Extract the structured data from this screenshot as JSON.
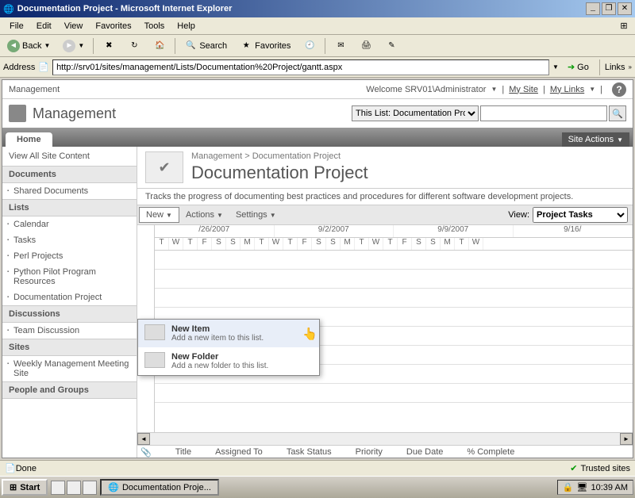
{
  "window": {
    "title": "Documentation Project - Microsoft Internet Explorer"
  },
  "menu": {
    "items": [
      "File",
      "Edit",
      "View",
      "Favorites",
      "Tools",
      "Help"
    ]
  },
  "toolbar": {
    "back": "Back",
    "search": "Search",
    "favorites": "Favorites"
  },
  "address": {
    "label": "Address",
    "url": "http://srv01/sites/management/Lists/Documentation%20Project/gantt.aspx",
    "go": "Go",
    "links": "Links"
  },
  "sp": {
    "topsite": "Management",
    "welcome": "Welcome SRV01\\Administrator",
    "mysite": "My Site",
    "mylinks": "My Links",
    "title": "Management",
    "scope": "This List: Documentation Project",
    "hometab": "Home",
    "siteactions": "Site Actions"
  },
  "sidebar": {
    "viewall": "View All Site Content",
    "sections": {
      "documents": {
        "title": "Documents",
        "items": [
          "Shared Documents"
        ]
      },
      "lists": {
        "title": "Lists",
        "items": [
          "Calendar",
          "Tasks",
          "Perl Projects",
          "Python Pilot Program Resources",
          "Documentation Project"
        ]
      },
      "discussions": {
        "title": "Discussions",
        "items": [
          "Team Discussion"
        ]
      },
      "sites": {
        "title": "Sites",
        "items": [
          "Weekly Management Meeting Site"
        ]
      },
      "people": {
        "title": "People and Groups"
      }
    }
  },
  "page": {
    "breadcrumb": "Management > Documentation Project",
    "title": "Documentation Project",
    "description": "Tracks the progress of documenting best practices and procedures for different software development projects."
  },
  "listbar": {
    "new": "New",
    "actions": "Actions",
    "settings": "Settings",
    "viewlabel": "View:",
    "viewname": "Project Tasks"
  },
  "dropdown": {
    "item1": {
      "title": "New Item",
      "desc": "Add a new item to this list."
    },
    "item2": {
      "title": "New Folder",
      "desc": "Add a new folder to this list."
    }
  },
  "gantt": {
    "dates": [
      "/26/2007",
      "9/2/2007",
      "9/9/2007",
      "9/16/"
    ],
    "days": [
      "T",
      "W",
      "T",
      "F",
      "S",
      "S",
      "M",
      "T",
      "W",
      "T",
      "F",
      "S",
      "S",
      "M",
      "T",
      "W",
      "T",
      "F",
      "S",
      "S",
      "M",
      "T",
      "W"
    ]
  },
  "columns": [
    "Title",
    "Assigned To",
    "Task Status",
    "Priority",
    "Due Date",
    "% Complete"
  ],
  "status": {
    "done": "Done",
    "trusted": "Trusted sites"
  },
  "taskbar": {
    "start": "Start",
    "task": "Documentation Proje...",
    "time": "10:39 AM"
  }
}
